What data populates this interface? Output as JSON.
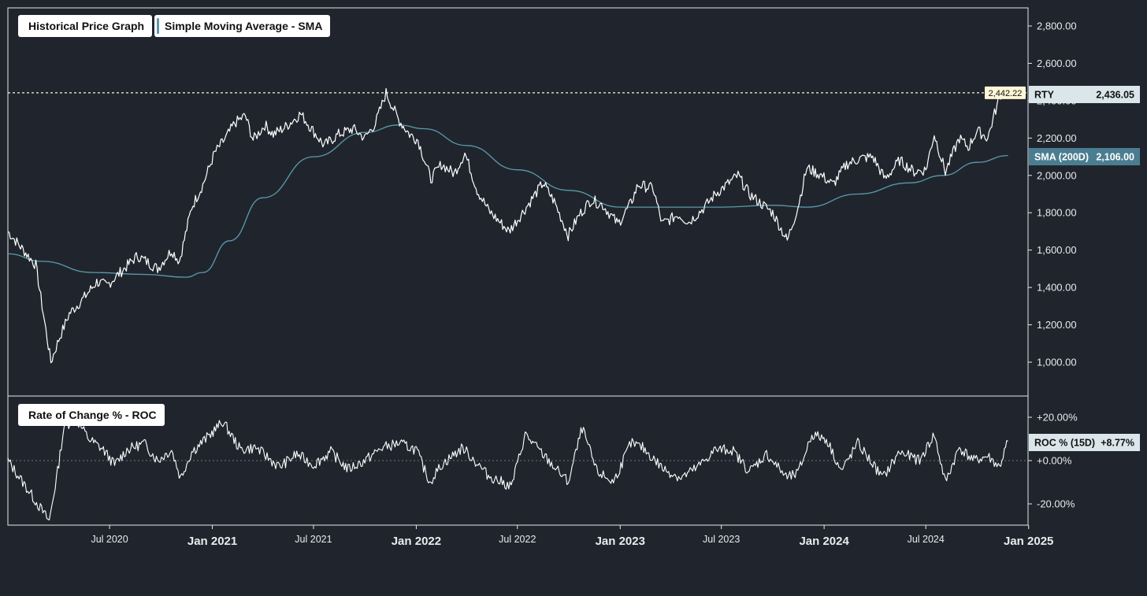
{
  "legend": {
    "price": "Historical Price Graph",
    "sma": "Simple Moving Average - SMA",
    "roc": "Rate of Change % - ROC"
  },
  "price_axis_ticks": [
    "2,800.00",
    "2,600.00",
    "2,400.00",
    "2,200.00",
    "2,000.00",
    "1,800.00",
    "1,600.00",
    "1,400.00",
    "1,200.00",
    "1,000.00"
  ],
  "roc_axis_ticks": [
    "+20.00%",
    "+0.00%",
    "-20.00%"
  ],
  "x_axis_ticks": [
    {
      "label": "Jul 2020",
      "major": false
    },
    {
      "label": "Jan 2021",
      "major": true
    },
    {
      "label": "Jul 2021",
      "major": false
    },
    {
      "label": "Jan 2022",
      "major": true
    },
    {
      "label": "Jul 2022",
      "major": false
    },
    {
      "label": "Jan 2023",
      "major": true
    },
    {
      "label": "Jul 2023",
      "major": false
    },
    {
      "label": "Jan 2024",
      "major": true
    },
    {
      "label": "Jul 2024",
      "major": false
    },
    {
      "label": "Jan 2025",
      "major": true
    }
  ],
  "badges": {
    "high": "2,442.22",
    "rty_name": "RTY",
    "rty_value": "2,436.05",
    "sma_name": "SMA (200D)",
    "sma_value": "2,106.00",
    "roc_name": "ROC % (15D)",
    "roc_value": "+8.77%"
  },
  "colors": {
    "background": "#20252d",
    "price_line": "#ffffff",
    "sma_line": "#5b9aab",
    "sma_badge": "#4b7d90",
    "high_badge": "#fff6d6",
    "label_badge": "#dbe6ea"
  },
  "chart_data": [
    {
      "type": "line",
      "title": "Historical Price Graph",
      "x_range": [
        "2020-01-01",
        "2024-12-31"
      ],
      "ylim": [
        800,
        2900
      ],
      "reference_line": 2442.22,
      "series": [
        {
          "name": "RTY",
          "x": [
            "2020-01-01",
            "2020-02-20",
            "2020-03-18",
            "2020-04-01",
            "2020-04-20",
            "2020-05-15",
            "2020-06-08",
            "2020-06-26",
            "2020-07-20",
            "2020-08-20",
            "2020-09-10",
            "2020-09-25",
            "2020-10-20",
            "2020-11-03",
            "2020-11-25",
            "2020-12-15",
            "2021-01-05",
            "2021-01-25",
            "2021-02-10",
            "2021-03-01",
            "2021-03-15",
            "2021-04-05",
            "2021-04-20",
            "2021-05-12",
            "2021-06-08",
            "2021-06-30",
            "2021-07-20",
            "2021-08-15",
            "2021-09-10",
            "2021-10-01",
            "2021-10-20",
            "2021-11-08",
            "2021-11-30",
            "2021-12-20",
            "2022-01-04",
            "2022-01-27",
            "2022-02-15",
            "2022-03-10",
            "2022-03-29",
            "2022-04-20",
            "2022-05-11",
            "2022-06-16",
            "2022-07-10",
            "2022-08-16",
            "2022-09-05",
            "2022-09-30",
            "2022-10-20",
            "2022-11-10",
            "2022-12-01",
            "2022-12-28",
            "2023-01-20",
            "2023-02-02",
            "2023-03-01",
            "2023-03-17",
            "2023-04-15",
            "2023-05-04",
            "2023-06-01",
            "2023-06-20",
            "2023-07-31",
            "2023-08-20",
            "2023-09-10",
            "2023-10-01",
            "2023-10-27",
            "2023-11-15",
            "2023-12-01",
            "2023-12-27",
            "2024-01-17",
            "2024-02-10",
            "2024-03-05",
            "2024-03-28",
            "2024-04-19",
            "2024-05-15",
            "2024-06-10",
            "2024-07-01",
            "2024-07-16",
            "2024-08-05",
            "2024-08-30",
            "2024-09-15",
            "2024-10-01",
            "2024-10-20",
            "2024-11-01",
            "2024-11-12",
            "2024-11-25"
          ],
          "y": [
            1700,
            1520,
            1000,
            1120,
            1260,
            1340,
            1430,
            1410,
            1480,
            1570,
            1530,
            1500,
            1600,
            1540,
            1830,
            1950,
            2120,
            2200,
            2280,
            2320,
            2190,
            2270,
            2220,
            2260,
            2330,
            2240,
            2160,
            2220,
            2250,
            2200,
            2280,
            2442,
            2300,
            2220,
            2190,
            1980,
            2060,
            2010,
            2120,
            1920,
            1810,
            1700,
            1800,
            1960,
            1860,
            1680,
            1790,
            1870,
            1840,
            1740,
            1850,
            1950,
            1930,
            1740,
            1790,
            1750,
            1830,
            1900,
            2000,
            1900,
            1850,
            1800,
            1650,
            1830,
            2040,
            2000,
            1950,
            2060,
            2090,
            2100,
            1980,
            2080,
            2020,
            2030,
            2220,
            2020,
            2200,
            2150,
            2240,
            2200,
            2330,
            2436,
            2442
          ]
        },
        {
          "name": "SMA (200D)",
          "x": [
            "2020-01-01",
            "2020-03-01",
            "2020-06-01",
            "2020-09-01",
            "2020-11-15",
            "2020-12-15",
            "2021-02-01",
            "2021-04-01",
            "2021-07-01",
            "2021-10-01",
            "2021-12-01",
            "2022-01-15",
            "2022-04-01",
            "2022-07-01",
            "2022-10-01",
            "2023-01-01",
            "2023-04-01",
            "2023-07-01",
            "2023-10-01",
            "2023-12-01",
            "2024-03-01",
            "2024-06-01",
            "2024-08-01",
            "2024-10-01",
            "2024-11-25"
          ],
          "y": [
            1580,
            1540,
            1480,
            1470,
            1455,
            1480,
            1650,
            1880,
            2100,
            2230,
            2270,
            2250,
            2160,
            2030,
            1920,
            1830,
            1830,
            1830,
            1840,
            1830,
            1900,
            1960,
            2000,
            2070,
            2106
          ]
        }
      ]
    },
    {
      "type": "line",
      "title": "Rate of Change % - ROC",
      "x_range": [
        "2020-01-01",
        "2024-12-31"
      ],
      "ylim": [
        -30,
        25
      ],
      "series": [
        {
          "name": "ROC % (15D)",
          "x": [
            "2020-01-01",
            "2020-02-10",
            "2020-03-15",
            "2020-03-30",
            "2020-04-10",
            "2020-04-30",
            "2020-05-25",
            "2020-06-20",
            "2020-07-10",
            "2020-08-01",
            "2020-09-01",
            "2020-09-25",
            "2020-10-20",
            "2020-11-05",
            "2020-11-25",
            "2020-12-20",
            "2021-01-20",
            "2021-02-20",
            "2021-03-20",
            "2021-05-01",
            "2021-06-01",
            "2021-07-01",
            "2021-08-01",
            "2021-09-01",
            "2021-10-01",
            "2021-11-01",
            "2021-12-01",
            "2022-01-01",
            "2022-01-25",
            "2022-02-15",
            "2022-03-25",
            "2022-05-10",
            "2022-06-20",
            "2022-07-15",
            "2022-08-15",
            "2022-09-30",
            "2022-10-25",
            "2022-11-20",
            "2022-12-20",
            "2023-01-20",
            "2023-02-10",
            "2023-03-20",
            "2023-04-20",
            "2023-05-20",
            "2023-06-20",
            "2023-07-20",
            "2023-08-20",
            "2023-09-20",
            "2023-10-27",
            "2023-11-15",
            "2023-12-10",
            "2024-01-05",
            "2024-02-01",
            "2024-03-01",
            "2024-04-15",
            "2024-05-15",
            "2024-06-20",
            "2024-07-16",
            "2024-08-05",
            "2024-08-30",
            "2024-09-25",
            "2024-10-20",
            "2024-11-10",
            "2024-11-25"
          ],
          "y": [
            0,
            -15,
            -28,
            -5,
            15,
            20,
            10,
            5,
            -2,
            5,
            8,
            0,
            5,
            -8,
            4,
            10,
            18,
            5,
            6,
            -3,
            3,
            -2,
            4,
            -4,
            0,
            6,
            8,
            5,
            -10,
            -2,
            6,
            -7,
            -12,
            12,
            3,
            -10,
            15,
            -5,
            -10,
            8,
            6,
            -4,
            -8,
            -3,
            5,
            5,
            -5,
            3,
            -8,
            -6,
            12,
            10,
            -5,
            8,
            -8,
            4,
            0,
            12,
            -10,
            6,
            0,
            2,
            -3,
            9
          ]
        }
      ]
    }
  ]
}
